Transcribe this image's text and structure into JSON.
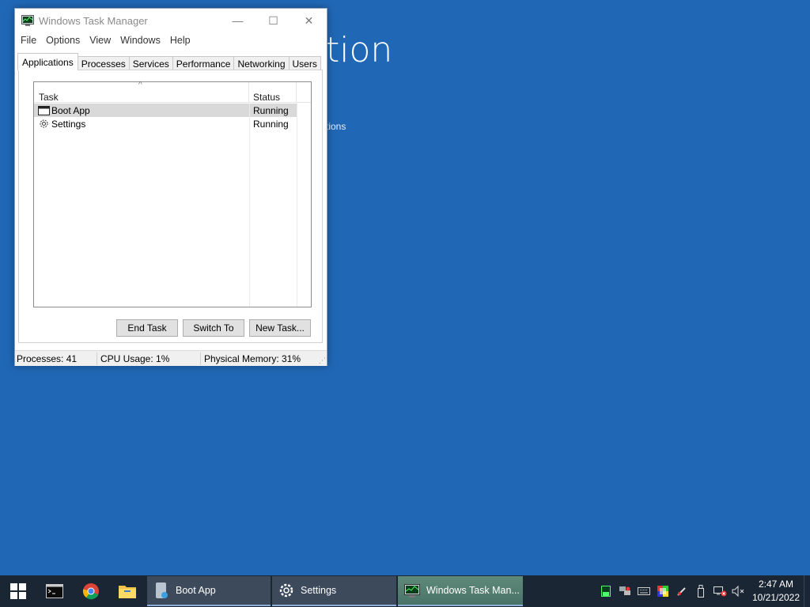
{
  "background_app": {
    "title_fragment": "tion",
    "subtitle_fragment": "tions"
  },
  "window": {
    "title": "Windows Task Manager",
    "controls": {
      "minimize": "—",
      "maximize": "☐",
      "close": "✕"
    }
  },
  "menu": [
    "File",
    "Options",
    "View",
    "Windows",
    "Help"
  ],
  "tabs": [
    {
      "label": "Applications",
      "active": true
    },
    {
      "label": "Processes"
    },
    {
      "label": "Services"
    },
    {
      "label": "Performance"
    },
    {
      "label": "Networking"
    },
    {
      "label": "Users"
    }
  ],
  "task_list": {
    "headers": {
      "task": "Task",
      "status": "Status"
    },
    "sort_indicator": "^",
    "rows": [
      {
        "name": "Boot App",
        "status": "Running",
        "icon": "window-icon",
        "selected": true
      },
      {
        "name": "Settings",
        "status": "Running",
        "icon": "gear-icon"
      }
    ]
  },
  "buttons": {
    "end_task": "End Task",
    "switch_to": "Switch To",
    "new_task": "New Task..."
  },
  "status_bar": {
    "processes": "Processes: 41",
    "cpu": "CPU Usage: 1%",
    "memory": "Physical Memory: 31%"
  },
  "taskbar": {
    "pinned": [
      "windows-start-icon",
      "terminal-icon",
      "chrome-icon",
      "file-explorer-icon"
    ],
    "apps": [
      {
        "label": "Boot App",
        "icon": "boot-app-icon"
      },
      {
        "label": "Settings",
        "icon": "gear-icon"
      },
      {
        "label": "Windows Task Man...",
        "icon": "task-manager-icon",
        "active": true
      }
    ],
    "tray": [
      "cpu-meter-icon",
      "network-icon",
      "keyboard-icon",
      "display-icon",
      "pen-icon",
      "usb-icon",
      "network-disconnected-icon",
      "volume-muted-icon"
    ],
    "clock": {
      "time": "2:47 AM",
      "date": "10/21/2022"
    }
  },
  "colors": {
    "desktop": "#2068b6",
    "taskbar": "#1b2635",
    "selected_row": "#d9d9d9"
  }
}
